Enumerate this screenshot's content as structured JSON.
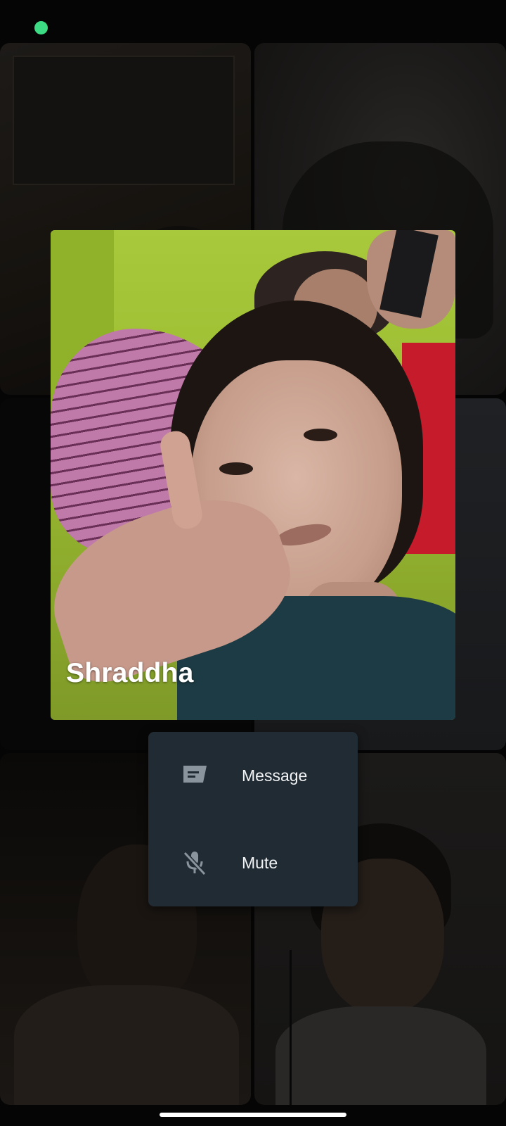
{
  "status_bar": {
    "indicator_color": "#3ddc84"
  },
  "call": {
    "focused_participant": {
      "name": "Shraddha"
    },
    "participant_menu": {
      "items": [
        {
          "label": "Message",
          "icon": "message-icon"
        },
        {
          "label": "Mute",
          "icon": "mic-off-icon"
        }
      ],
      "background": "#212b34"
    }
  },
  "colors": {
    "background": "#050505",
    "menu_text": "#f1f3f4",
    "icon": "#8a949c"
  }
}
